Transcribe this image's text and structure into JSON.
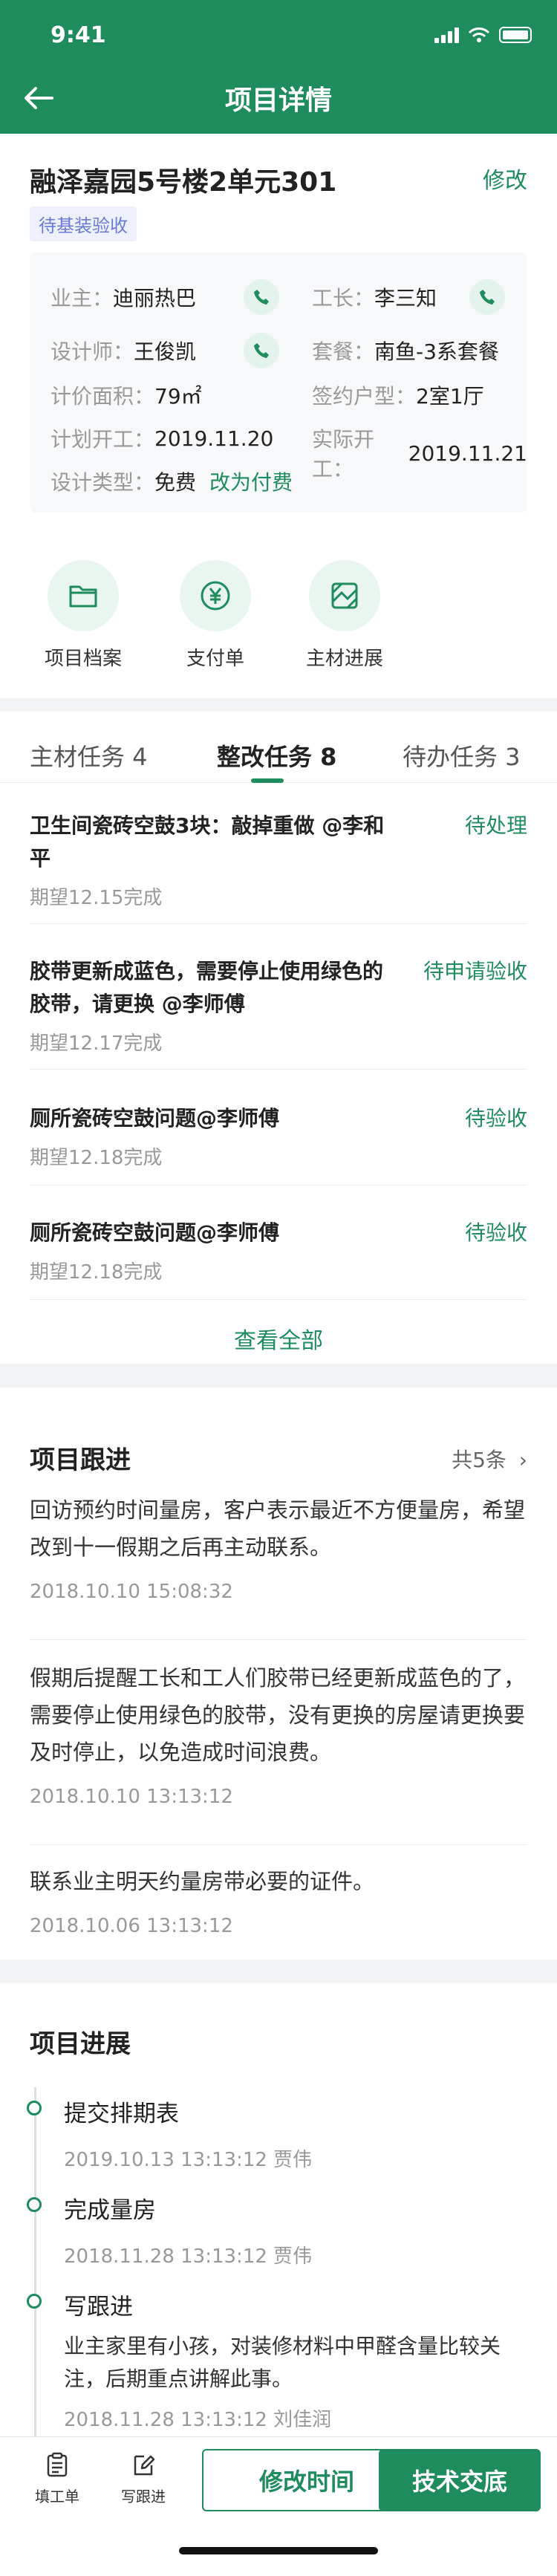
{
  "status_bar": {
    "time": "9:41"
  },
  "nav": {
    "title": "项目详情"
  },
  "project": {
    "title": "融泽嘉园5号楼2单元301",
    "edit_label": "修改",
    "status_tag": "待基装验收",
    "info": {
      "owner_label": "业主：",
      "owner": "迪丽热巴",
      "foreman_label": "工长：",
      "foreman": "李三知",
      "designer_label": "设计师：",
      "designer": "王俊凯",
      "package_label": "套餐：",
      "package": "南鱼-3系套餐",
      "area_label": "计价面积：",
      "area": "79㎡",
      "layout_label": "签约户型：",
      "layout": "2室1厅",
      "plan_start_label": "计划开工：",
      "plan_start": "2019.11.20",
      "actual_start_label": "实际开工：",
      "actual_start": "2019.11.21",
      "design_type_label": "设计类型：",
      "design_type": "免费",
      "change_paid": "改为付费"
    },
    "shortcuts": [
      {
        "label": "项目档案",
        "icon": "folder-icon"
      },
      {
        "label": "支付单",
        "icon": "yuan-icon"
      },
      {
        "label": "主材进展",
        "icon": "material-icon"
      }
    ]
  },
  "tasks": {
    "tabs": [
      {
        "label": "主材任务 4"
      },
      {
        "label": "整改任务 8"
      },
      {
        "label": "待办任务 3"
      }
    ],
    "items": [
      {
        "title": "卫生间瓷砖空鼓3块：敲掉重做 @李和平",
        "status": "待处理",
        "date": "期望12.15完成"
      },
      {
        "title": "胶带更新成蓝色，需要停止使用绿色的胶带，请更换 @李师傅",
        "status": "待申请验收",
        "date": "期望12.17完成"
      },
      {
        "title": "厕所瓷砖空鼓问题@李师傅",
        "status": "待验收",
        "date": "期望12.18完成"
      },
      {
        "title": "厕所瓷砖空鼓问题@李师傅",
        "status": "待验收",
        "date": "期望12.18完成"
      }
    ],
    "view_all": "查看全部"
  },
  "followups": {
    "title": "项目跟进",
    "count": "共5条",
    "items": [
      {
        "content": "回访预约时间量房，客户表示最近不方便量房，希望改到十一假期之后再主动联系。",
        "time": "2018.10.10 15:08:32"
      },
      {
        "content": "假期后提醒工长和工人们胶带已经更新成蓝色的了，需要停止使用绿色的胶带，没有更换的房屋请更换要及时停止，以免造成时间浪费。",
        "time": "2018.10.10 13:13:12"
      },
      {
        "content": "联系业主明天约量房带必要的证件。",
        "time": "2018.10.06 13:13:12"
      }
    ]
  },
  "progress": {
    "title": "项目进展",
    "steps": [
      {
        "title": "提交排期表",
        "meta": "2019.10.13 13:13:12 贾伟"
      },
      {
        "title": "完成量房",
        "meta": "2018.11.28 13:13:12 贾伟"
      },
      {
        "title": "写跟进",
        "body": "业主家里有小孩，对装修材料中甲醛含量比较关注，后期重点讲解此事。",
        "meta": "2018.11.28 13:13:12 刘佳润"
      }
    ]
  },
  "bottom": {
    "fill_form": "填工单",
    "write_followup": "写跟进",
    "modify_time": "修改时间",
    "tech_handover": "技术交底"
  },
  "colors": {
    "brand": "#1f8c5e",
    "tag_bg": "#eef1fb",
    "tag_text": "#6a7bd6"
  }
}
